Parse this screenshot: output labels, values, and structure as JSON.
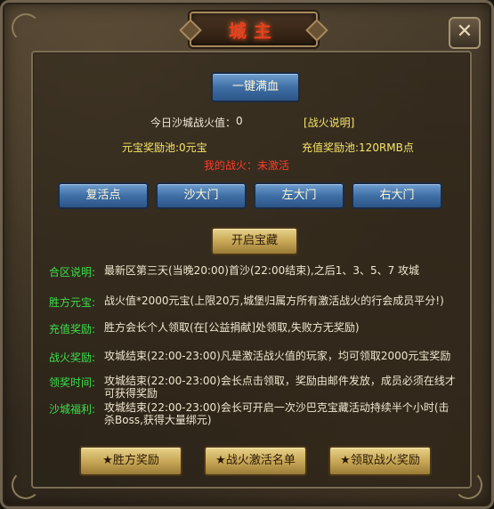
{
  "title": "城主",
  "close_icon": "close-icon",
  "top_button": "一键满血",
  "fire_value_label": "今日沙城战火值：",
  "fire_value": "0",
  "fire_explain": "[战火说明]",
  "yuanbao_pool": "元宝奖励池:0元宝",
  "recharge_pool": "充值奖励池:120RMB点",
  "my_fire": "我的战火：未激活",
  "gates": [
    "复活点",
    "沙大门",
    "左大门",
    "右大门"
  ],
  "treasure_button": "开启宝藏",
  "rows": [
    {
      "label": "合区说明:",
      "text": "最新区第三天(当晚20:00)首沙(22:00结束),之后1、3、5、7 攻城"
    },
    {
      "label": "胜方元宝:",
      "text": "战火值*2000元宝(上限20万,城堡归属方所有激活战火的行会成员平分!)"
    },
    {
      "label": "充值奖励:",
      "text": "胜方会长个人领取(在[公益捐献]处领取,失败方无奖励)"
    },
    {
      "label": "战火奖励:",
      "text": "攻城结束(22:00-23:00)凡是激活战火值的玩家，均可领取2000元宝奖励"
    },
    {
      "label": "领奖时间:",
      "text": "攻城结束(22:00-23:00)会长点击领取，奖励由邮件发放，成员必须在线才可获得奖励"
    },
    {
      "label": "沙城福利:",
      "text": "攻城结束(22:00-23:00)会长可开启一次沙巴克宝藏活动持续半个小时(击杀Boss,获得大量绑元)"
    }
  ],
  "bottom_buttons": [
    "★胜方奖励",
    "★战火激活名单",
    "★领取战火奖励"
  ]
}
